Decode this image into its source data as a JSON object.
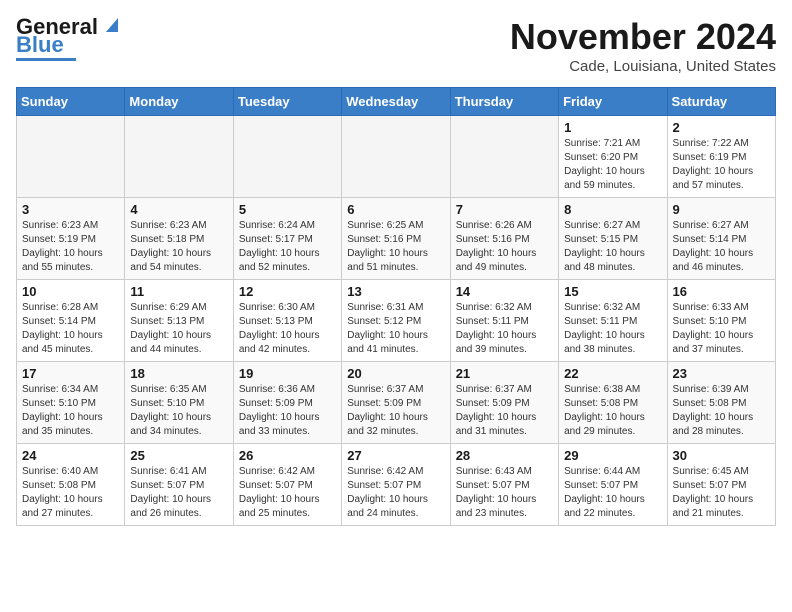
{
  "header": {
    "logo_general": "General",
    "logo_blue": "Blue",
    "month_title": "November 2024",
    "location": "Cade, Louisiana, United States"
  },
  "calendar": {
    "weekdays": [
      "Sunday",
      "Monday",
      "Tuesday",
      "Wednesday",
      "Thursday",
      "Friday",
      "Saturday"
    ],
    "weeks": [
      [
        {
          "day": "",
          "info": ""
        },
        {
          "day": "",
          "info": ""
        },
        {
          "day": "",
          "info": ""
        },
        {
          "day": "",
          "info": ""
        },
        {
          "day": "",
          "info": ""
        },
        {
          "day": "1",
          "info": "Sunrise: 7:21 AM\nSunset: 6:20 PM\nDaylight: 10 hours\nand 59 minutes."
        },
        {
          "day": "2",
          "info": "Sunrise: 7:22 AM\nSunset: 6:19 PM\nDaylight: 10 hours\nand 57 minutes."
        }
      ],
      [
        {
          "day": "3",
          "info": "Sunrise: 6:23 AM\nSunset: 5:19 PM\nDaylight: 10 hours\nand 55 minutes."
        },
        {
          "day": "4",
          "info": "Sunrise: 6:23 AM\nSunset: 5:18 PM\nDaylight: 10 hours\nand 54 minutes."
        },
        {
          "day": "5",
          "info": "Sunrise: 6:24 AM\nSunset: 5:17 PM\nDaylight: 10 hours\nand 52 minutes."
        },
        {
          "day": "6",
          "info": "Sunrise: 6:25 AM\nSunset: 5:16 PM\nDaylight: 10 hours\nand 51 minutes."
        },
        {
          "day": "7",
          "info": "Sunrise: 6:26 AM\nSunset: 5:16 PM\nDaylight: 10 hours\nand 49 minutes."
        },
        {
          "day": "8",
          "info": "Sunrise: 6:27 AM\nSunset: 5:15 PM\nDaylight: 10 hours\nand 48 minutes."
        },
        {
          "day": "9",
          "info": "Sunrise: 6:27 AM\nSunset: 5:14 PM\nDaylight: 10 hours\nand 46 minutes."
        }
      ],
      [
        {
          "day": "10",
          "info": "Sunrise: 6:28 AM\nSunset: 5:14 PM\nDaylight: 10 hours\nand 45 minutes."
        },
        {
          "day": "11",
          "info": "Sunrise: 6:29 AM\nSunset: 5:13 PM\nDaylight: 10 hours\nand 44 minutes."
        },
        {
          "day": "12",
          "info": "Sunrise: 6:30 AM\nSunset: 5:13 PM\nDaylight: 10 hours\nand 42 minutes."
        },
        {
          "day": "13",
          "info": "Sunrise: 6:31 AM\nSunset: 5:12 PM\nDaylight: 10 hours\nand 41 minutes."
        },
        {
          "day": "14",
          "info": "Sunrise: 6:32 AM\nSunset: 5:11 PM\nDaylight: 10 hours\nand 39 minutes."
        },
        {
          "day": "15",
          "info": "Sunrise: 6:32 AM\nSunset: 5:11 PM\nDaylight: 10 hours\nand 38 minutes."
        },
        {
          "day": "16",
          "info": "Sunrise: 6:33 AM\nSunset: 5:10 PM\nDaylight: 10 hours\nand 37 minutes."
        }
      ],
      [
        {
          "day": "17",
          "info": "Sunrise: 6:34 AM\nSunset: 5:10 PM\nDaylight: 10 hours\nand 35 minutes."
        },
        {
          "day": "18",
          "info": "Sunrise: 6:35 AM\nSunset: 5:10 PM\nDaylight: 10 hours\nand 34 minutes."
        },
        {
          "day": "19",
          "info": "Sunrise: 6:36 AM\nSunset: 5:09 PM\nDaylight: 10 hours\nand 33 minutes."
        },
        {
          "day": "20",
          "info": "Sunrise: 6:37 AM\nSunset: 5:09 PM\nDaylight: 10 hours\nand 32 minutes."
        },
        {
          "day": "21",
          "info": "Sunrise: 6:37 AM\nSunset: 5:09 PM\nDaylight: 10 hours\nand 31 minutes."
        },
        {
          "day": "22",
          "info": "Sunrise: 6:38 AM\nSunset: 5:08 PM\nDaylight: 10 hours\nand 29 minutes."
        },
        {
          "day": "23",
          "info": "Sunrise: 6:39 AM\nSunset: 5:08 PM\nDaylight: 10 hours\nand 28 minutes."
        }
      ],
      [
        {
          "day": "24",
          "info": "Sunrise: 6:40 AM\nSunset: 5:08 PM\nDaylight: 10 hours\nand 27 minutes."
        },
        {
          "day": "25",
          "info": "Sunrise: 6:41 AM\nSunset: 5:07 PM\nDaylight: 10 hours\nand 26 minutes."
        },
        {
          "day": "26",
          "info": "Sunrise: 6:42 AM\nSunset: 5:07 PM\nDaylight: 10 hours\nand 25 minutes."
        },
        {
          "day": "27",
          "info": "Sunrise: 6:42 AM\nSunset: 5:07 PM\nDaylight: 10 hours\nand 24 minutes."
        },
        {
          "day": "28",
          "info": "Sunrise: 6:43 AM\nSunset: 5:07 PM\nDaylight: 10 hours\nand 23 minutes."
        },
        {
          "day": "29",
          "info": "Sunrise: 6:44 AM\nSunset: 5:07 PM\nDaylight: 10 hours\nand 22 minutes."
        },
        {
          "day": "30",
          "info": "Sunrise: 6:45 AM\nSunset: 5:07 PM\nDaylight: 10 hours\nand 21 minutes."
        }
      ]
    ]
  }
}
